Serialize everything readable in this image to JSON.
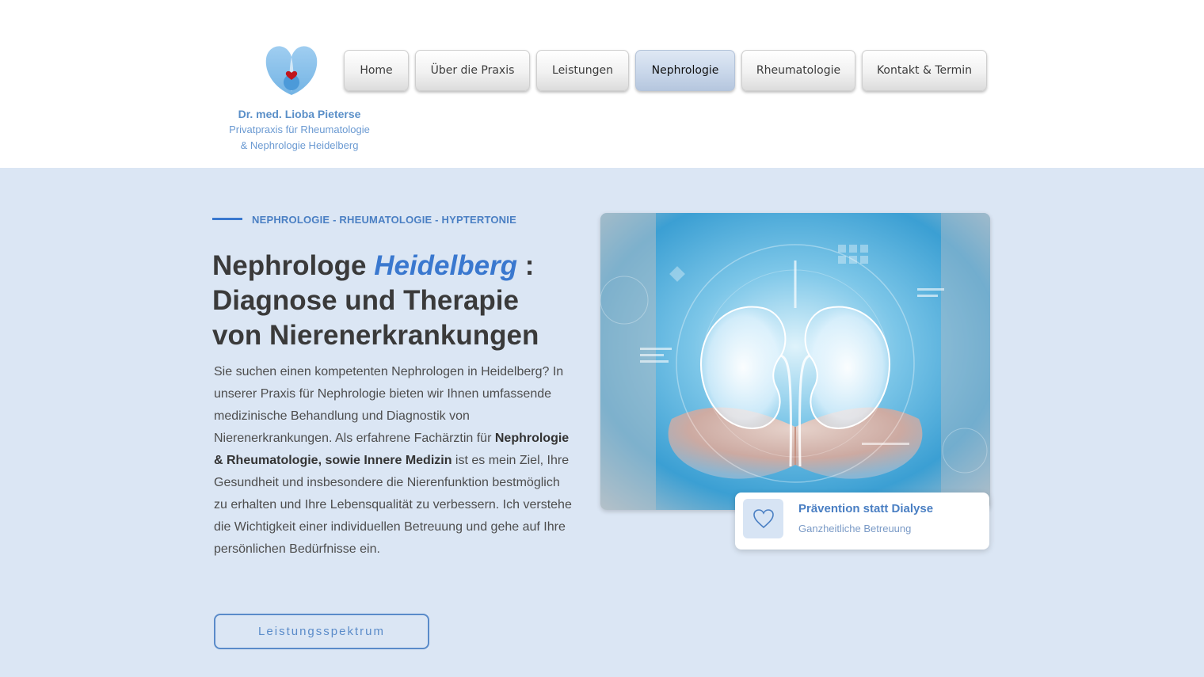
{
  "brand": {
    "name": "Dr. med. Lioba Pieterse",
    "subtitle_line1": "Privatpraxis für Rheumatologie",
    "subtitle_line2": "& Nephrologie Heidelberg"
  },
  "nav": {
    "items": [
      {
        "label": "Home",
        "active": false
      },
      {
        "label": "Über die Praxis",
        "active": false
      },
      {
        "label": "Leistungen",
        "active": false
      },
      {
        "label": "Nephrologie",
        "active": true
      },
      {
        "label": "Rheumatologie",
        "active": false
      },
      {
        "label": "Kontakt & Termin",
        "active": false
      }
    ]
  },
  "hero": {
    "eyebrow": "NEPHROLOGIE - RHEUMATOLOGIE - HYPTERTONIE",
    "headline_part1": "Nephrologe ",
    "headline_highlight": "Heidelberg",
    "headline_part2": " :",
    "headline_line2": "Diagnose und Therapie",
    "headline_line3": "von Nierenerkrankungen",
    "body_part1": "Sie suchen einen kompetenten Nephrologen in Heidelberg? In unserer Praxis für Nephrologie bieten wir Ihnen umfassende medizinische Behandlung und Diagnostik von Nierenerkrankungen. Als erfahrene Fachärztin für ",
    "body_bold": "Nephrologie & Rheumatologie, sowie Innere Medizin",
    "body_part2": " ist es mein Ziel, Ihre Gesundheit und insbesondere die Nierenfunktion bestmöglich zu erhalten und Ihre Lebensqualität zu verbessern. Ich verstehe die Wichtigkeit einer individuellen Betreuung und gehe auf Ihre persönlichen Bedürfnisse ein.",
    "cta_label": "Leistungsspektrum"
  },
  "card": {
    "title": "Prävention statt Dialyse",
    "subtitle": "Ganzheitliche Betreuung",
    "icon": "heart-outline-icon"
  },
  "colors": {
    "accent": "#3a78cf",
    "hero_bg": "#dbe6f4",
    "brand_text": "#5a8fc8"
  }
}
